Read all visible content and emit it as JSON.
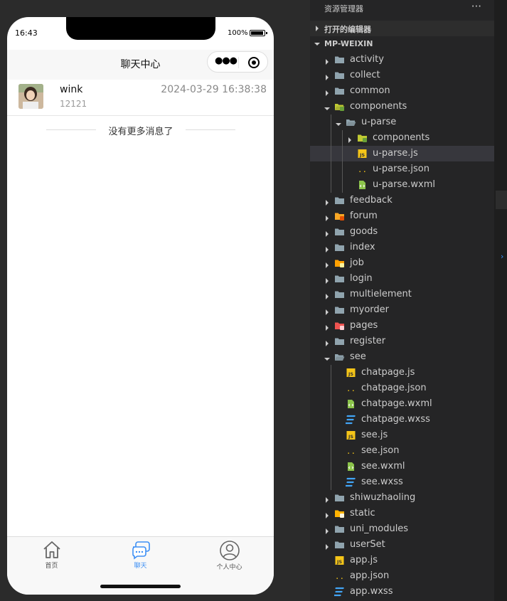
{
  "phone": {
    "status_time": "16:43",
    "battery_label": "100%",
    "battery_level": 1.0,
    "title": "聊天中心",
    "chats": [
      {
        "name": "wink",
        "message": "12121",
        "time": "2024-03-29 16:38:38"
      }
    ],
    "no_more_text": "没有更多消息了",
    "tabs": [
      {
        "label": "首页",
        "icon": "home-icon",
        "active": false
      },
      {
        "label": "聊天",
        "icon": "chat-icon",
        "active": true
      },
      {
        "label": "个人中心",
        "icon": "user-icon",
        "active": false
      }
    ],
    "active_tab_color": "#3d8ff5"
  },
  "explorer": {
    "title": "资源管理器",
    "more_icon": "···",
    "sections": {
      "open_editors": "打开的编辑器",
      "project": "MP-WEIXIN"
    },
    "tree": [
      {
        "label": "activity",
        "depth": 0,
        "type": "folder",
        "expanded": false,
        "icon": "folder-icon"
      },
      {
        "label": "collect",
        "depth": 0,
        "type": "folder",
        "expanded": false,
        "icon": "folder-icon"
      },
      {
        "label": "common",
        "depth": 0,
        "type": "folder",
        "expanded": false,
        "icon": "folder-icon"
      },
      {
        "label": "components",
        "depth": 0,
        "type": "folder",
        "expanded": true,
        "icon": "components-folder-open-icon"
      },
      {
        "label": "u-parse",
        "depth": 1,
        "type": "folder",
        "expanded": true,
        "icon": "folder-open-icon"
      },
      {
        "label": "components",
        "depth": 2,
        "type": "folder",
        "expanded": false,
        "icon": "components-folder-icon"
      },
      {
        "label": "u-parse.js",
        "depth": 2,
        "type": "file",
        "icon": "js-file-icon",
        "selected": true
      },
      {
        "label": "u-parse.json",
        "depth": 2,
        "type": "file",
        "icon": "json-file-icon"
      },
      {
        "label": "u-parse.wxml",
        "depth": 2,
        "type": "file",
        "icon": "wxml-file-icon"
      },
      {
        "label": "feedback",
        "depth": 0,
        "type": "folder",
        "expanded": false,
        "icon": "folder-icon"
      },
      {
        "label": "forum",
        "depth": 0,
        "type": "folder",
        "expanded": false,
        "icon": "forum-folder-icon"
      },
      {
        "label": "goods",
        "depth": 0,
        "type": "folder",
        "expanded": false,
        "icon": "folder-icon"
      },
      {
        "label": "index",
        "depth": 0,
        "type": "folder",
        "expanded": false,
        "icon": "folder-icon"
      },
      {
        "label": "job",
        "depth": 0,
        "type": "folder",
        "expanded": false,
        "icon": "job-folder-icon"
      },
      {
        "label": "login",
        "depth": 0,
        "type": "folder",
        "expanded": false,
        "icon": "folder-icon"
      },
      {
        "label": "multielement",
        "depth": 0,
        "type": "folder",
        "expanded": false,
        "icon": "folder-icon"
      },
      {
        "label": "myorder",
        "depth": 0,
        "type": "folder",
        "expanded": false,
        "icon": "folder-icon"
      },
      {
        "label": "pages",
        "depth": 0,
        "type": "folder",
        "expanded": false,
        "icon": "pages-folder-icon"
      },
      {
        "label": "register",
        "depth": 0,
        "type": "folder",
        "expanded": false,
        "icon": "folder-icon"
      },
      {
        "label": "see",
        "depth": 0,
        "type": "folder",
        "expanded": true,
        "icon": "folder-open-icon"
      },
      {
        "label": "chatpage.js",
        "depth": 1,
        "type": "file",
        "icon": "js-file-icon"
      },
      {
        "label": "chatpage.json",
        "depth": 1,
        "type": "file",
        "icon": "json-file-icon"
      },
      {
        "label": "chatpage.wxml",
        "depth": 1,
        "type": "file",
        "icon": "wxml-file-icon"
      },
      {
        "label": "chatpage.wxss",
        "depth": 1,
        "type": "file",
        "icon": "wxss-file-icon"
      },
      {
        "label": "see.js",
        "depth": 1,
        "type": "file",
        "icon": "js-file-icon"
      },
      {
        "label": "see.json",
        "depth": 1,
        "type": "file",
        "icon": "json-file-icon"
      },
      {
        "label": "see.wxml",
        "depth": 1,
        "type": "file",
        "icon": "wxml-file-icon"
      },
      {
        "label": "see.wxss",
        "depth": 1,
        "type": "file",
        "icon": "wxss-file-icon"
      },
      {
        "label": "shiwuzhaoling",
        "depth": 0,
        "type": "folder",
        "expanded": false,
        "icon": "folder-icon"
      },
      {
        "label": "static",
        "depth": 0,
        "type": "folder",
        "expanded": false,
        "icon": "static-folder-icon"
      },
      {
        "label": "uni_modules",
        "depth": 0,
        "type": "folder",
        "expanded": false,
        "icon": "folder-icon"
      },
      {
        "label": "userSet",
        "depth": 0,
        "type": "folder",
        "expanded": false,
        "icon": "folder-icon"
      },
      {
        "label": "app.js",
        "depth": 0,
        "type": "file",
        "icon": "js-file-icon"
      },
      {
        "label": "app.json",
        "depth": 0,
        "type": "file",
        "icon": "json-file-icon"
      },
      {
        "label": "app.wxss",
        "depth": 0,
        "type": "file",
        "icon": "wxss-file-icon"
      }
    ],
    "colors": {
      "folder": "#90a4ae",
      "js": "#f5c518",
      "json": "#f5c518",
      "wxml": "#8bc34a",
      "wxss": "#42a5f5",
      "components_folder": "#c0ca33",
      "forum_folder": "#f9a825",
      "job_folder": "#ffa000",
      "pages_folder": "#ef5350",
      "static_folder": "#ffb300"
    }
  }
}
